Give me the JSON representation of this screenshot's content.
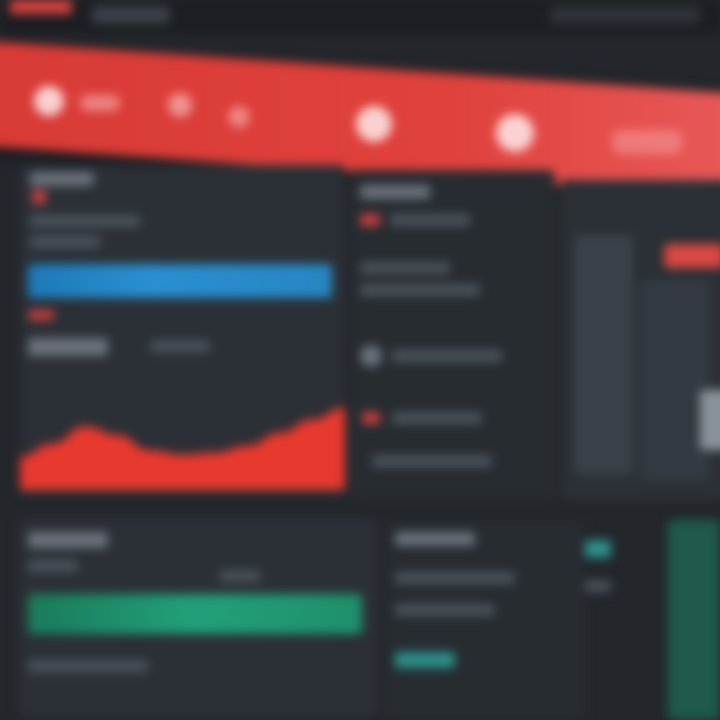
{
  "colors": {
    "background": "#23272c",
    "header_red": "#e0413c",
    "accent_blue": "#2a8fd0",
    "accent_green": "#22a07a",
    "area_red": "#e8392f"
  },
  "header": {
    "nav_icons": [
      "dot-icon",
      "dot-icon",
      "dot-icon",
      "dot-icon",
      "dot-icon",
      "dot-icon"
    ]
  },
  "chart_data": {
    "type": "area",
    "x": [
      0,
      1,
      2,
      3,
      4,
      5,
      6,
      7,
      8,
      9,
      10
    ],
    "values": [
      3.0,
      4.2,
      5.8,
      5.0,
      3.6,
      3.2,
      3.4,
      4.0,
      5.2,
      6.4,
      7.5
    ],
    "ylim": [
      0,
      10
    ],
    "title": "",
    "xlabel": "",
    "ylabel": "",
    "grid": false,
    "legend": "none"
  }
}
